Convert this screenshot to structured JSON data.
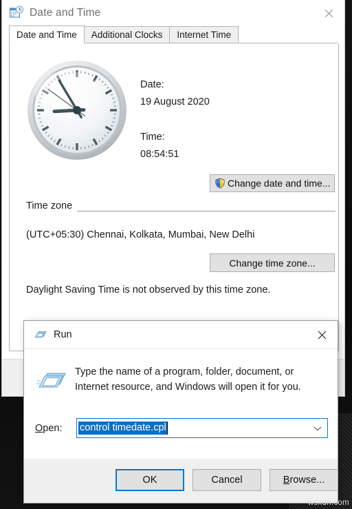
{
  "main_window": {
    "title": "Date and Time",
    "title_icon": "calendar-clock-icon",
    "close_icon": "close-icon",
    "tabs": [
      {
        "label": "Date and Time",
        "active": true
      },
      {
        "label": "Additional Clocks",
        "active": false
      },
      {
        "label": "Internet Time",
        "active": false
      }
    ],
    "clock_icon": "analog-clock",
    "date_label": "Date:",
    "date_value": "19 August 2020",
    "time_label": "Time:",
    "time_value": "08:54:51",
    "change_datetime_button": "Change date and time...",
    "shield_icon": "uac-shield-icon",
    "timezone_group_label": "Time zone",
    "timezone_value": "(UTC+05:30) Chennai, Kolkata, Mumbai, New Delhi",
    "change_timezone_button": "Change time zone...",
    "dst_note": "Daylight Saving Time is not observed by this time zone."
  },
  "run_dialog": {
    "title": "Run",
    "title_icon": "run-window-icon",
    "close_icon": "close-icon",
    "big_icon": "run-window-icon-large",
    "description": "Type the name of a program, folder, document, or Internet resource, and Windows will open it for you.",
    "open_label_prefix": "O",
    "open_label_rest": "pen:",
    "open_value": "control timedate.cpl",
    "dropdown_icon": "chevron-down-icon",
    "buttons": {
      "ok": "OK",
      "cancel": "Cancel",
      "browse_prefix": "B",
      "browse_rest": "rowse..."
    }
  },
  "clock_hands": {
    "hour_deg": 267,
    "minute_deg": 329,
    "second_deg": 306
  },
  "colors": {
    "accent": "#0078d7",
    "selection": "#0b6fc4",
    "button_face": "#e1e1e1",
    "window_bg": "#ffffff",
    "dialog_bg": "#f0f0f0"
  },
  "watermark": "wsxdn.com"
}
